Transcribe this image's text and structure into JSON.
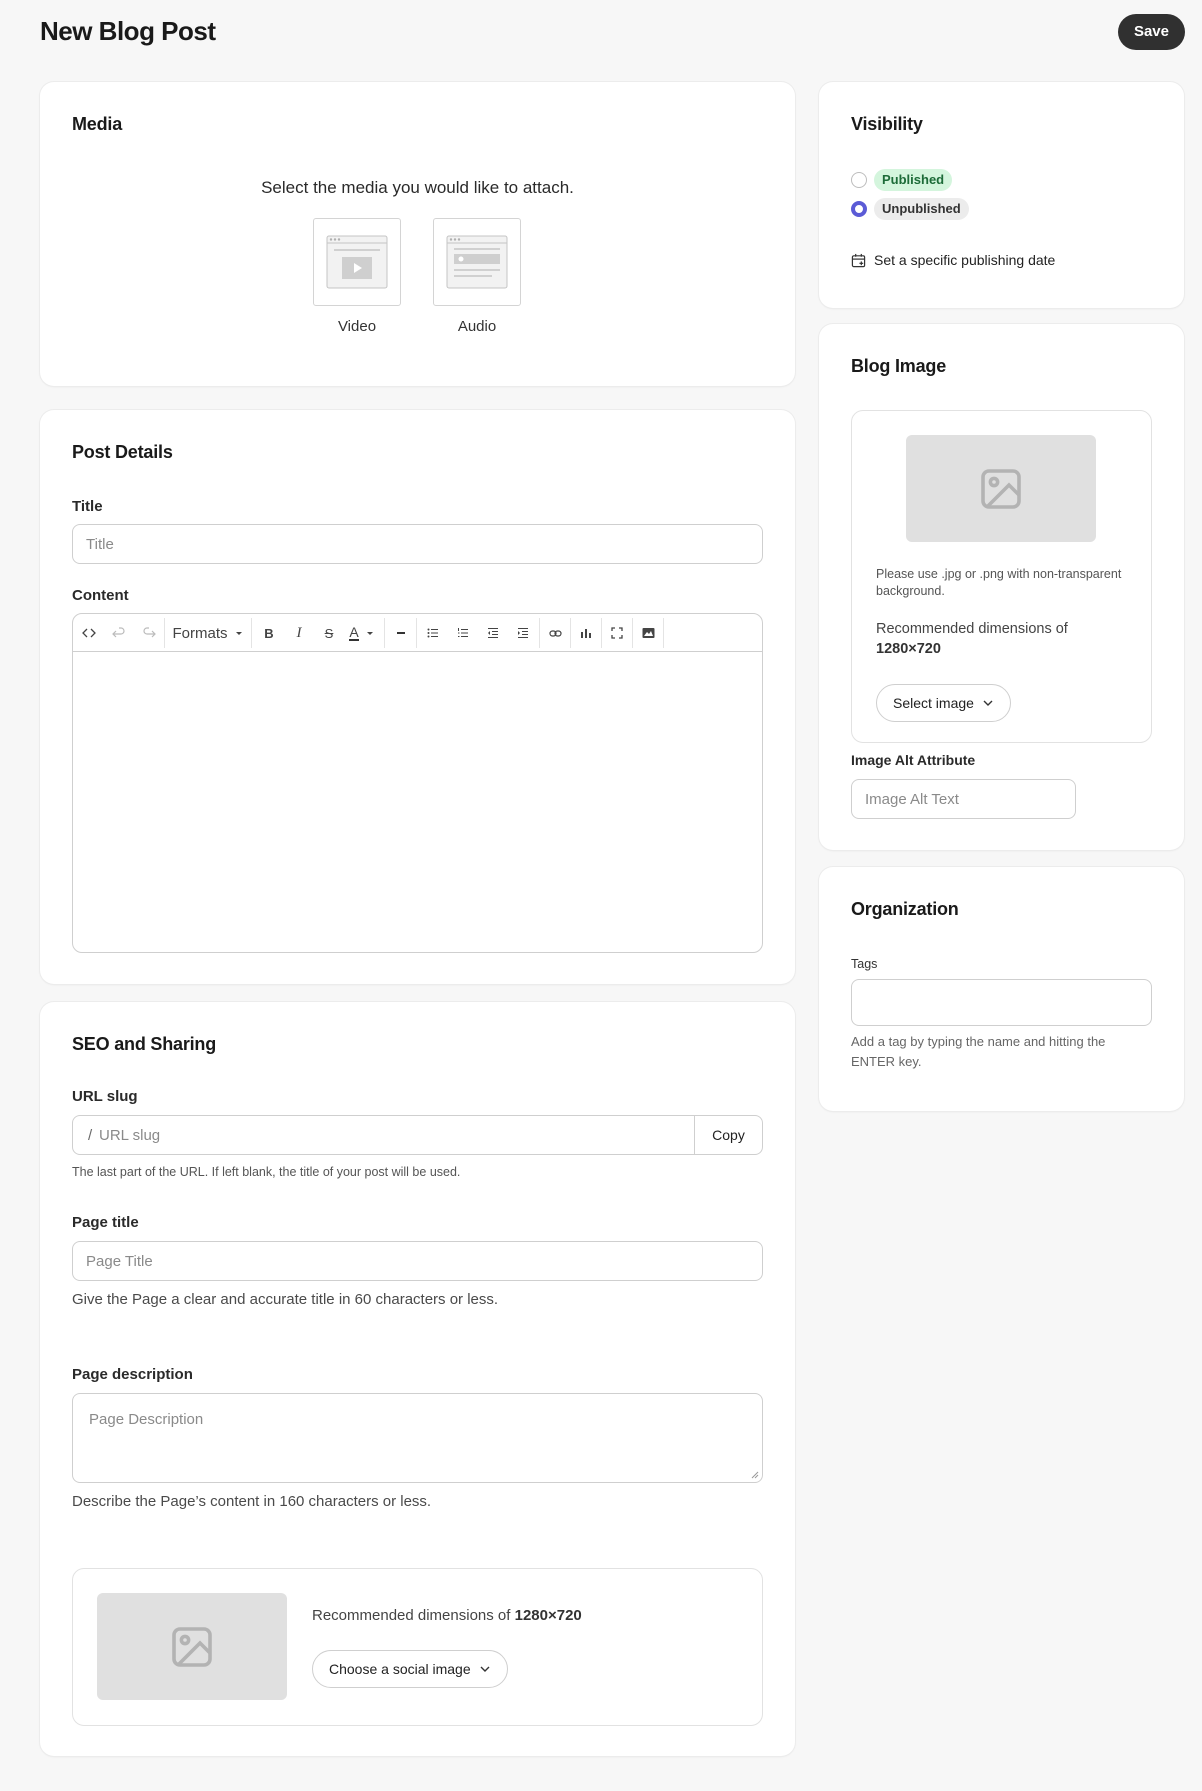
{
  "header": {
    "title": "New Blog Post",
    "save_label": "Save"
  },
  "media": {
    "title": "Media",
    "prompt": "Select the media you would like to attach.",
    "options": [
      {
        "label": "Video",
        "icon": "video-icon"
      },
      {
        "label": "Audio",
        "icon": "audio-icon"
      }
    ]
  },
  "post_details": {
    "title": "Post Details",
    "title_label": "Title",
    "title_placeholder": "Title",
    "content_label": "Content",
    "formats_label": "Formats",
    "toolbar_icons": [
      "source-code-icon",
      "undo-icon",
      "redo-icon",
      "formats-dropdown",
      "bold-icon",
      "italic-icon",
      "strikethrough-icon",
      "text-color-icon",
      "horizontal-rule-icon",
      "bullet-list-icon",
      "numbered-list-icon",
      "outdent-icon",
      "indent-icon",
      "link-icon",
      "chart-icon",
      "fullscreen-icon",
      "image-icon"
    ]
  },
  "seo": {
    "title": "SEO and Sharing",
    "slug_label": "URL slug",
    "slug_prefix": "/",
    "slug_placeholder": "URL slug",
    "copy_label": "Copy",
    "slug_help": "The last part of the URL. If left blank, the title of your post will be used.",
    "page_title_label": "Page title",
    "page_title_placeholder": "Page Title",
    "page_title_help": "Give the Page a clear and accurate title in 60 characters or less.",
    "page_desc_label": "Page description",
    "page_desc_placeholder": "Page Description",
    "page_desc_help": "Describe the Page’s content in 160 characters or less.",
    "social_dims_prefix": "Recommended dimensions of ",
    "social_dims_value": "1280×720",
    "social_button": "Choose a social image"
  },
  "visibility": {
    "title": "Visibility",
    "options": [
      {
        "label": "Published",
        "selected": false
      },
      {
        "label": "Unpublished",
        "selected": true
      }
    ],
    "schedule_label": "Set a specific publishing date"
  },
  "blog_image": {
    "title": "Blog Image",
    "note": "Please use .jpg or .png with non-transparent background.",
    "dims_prefix": "Recommended dimensions of",
    "dims_value": "1280×720",
    "select_button": "Select image",
    "alt_label": "Image Alt Attribute",
    "alt_placeholder": "Image Alt Text"
  },
  "organization": {
    "title": "Organization",
    "tags_label": "Tags",
    "tags_value": "",
    "tags_help": "Add a tag by typing the name and hitting the ENTER key."
  },
  "colors": {
    "accent": "#5b5bd6",
    "published_bg": "#d4f5dd",
    "published_text": "#1d6b38",
    "unpublished_bg": "#ececec",
    "save_bg": "#303030"
  }
}
